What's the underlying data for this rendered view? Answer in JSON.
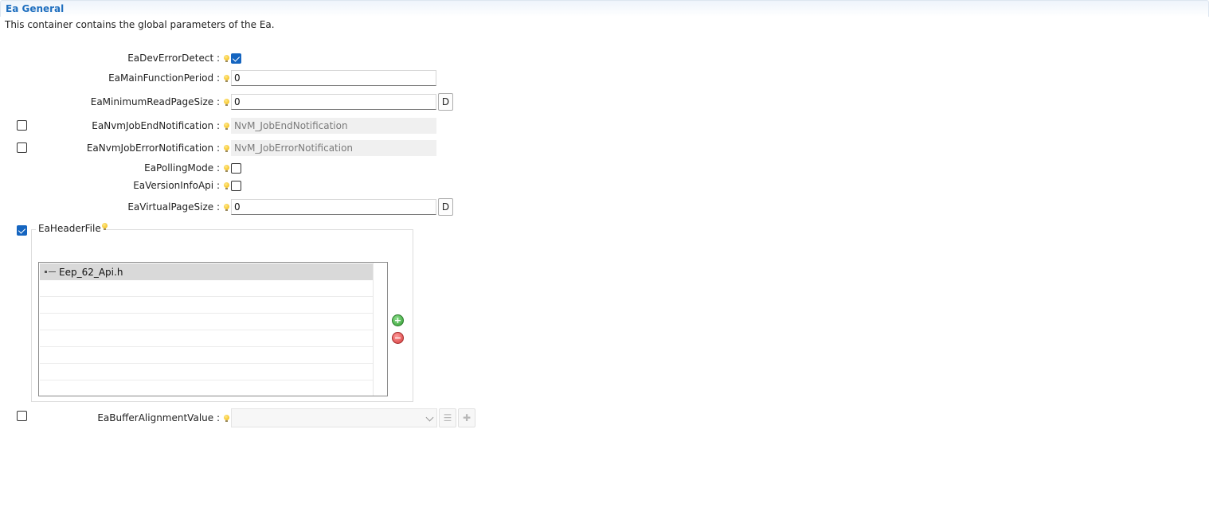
{
  "section": {
    "title": "Ea General",
    "description": "This container contains the global parameters of the Ea."
  },
  "params": {
    "dev_error_detect": {
      "label": "EaDevErrorDetect :",
      "checked": true
    },
    "main_function_period": {
      "label": "EaMainFunctionPeriod :",
      "value": "0"
    },
    "minimum_read_page_size": {
      "label": "EaMinimumReadPageSize :",
      "value": "0",
      "default_button": "D"
    },
    "nvm_job_end_notification": {
      "label": "EaNvmJobEndNotification :",
      "enabled": false,
      "value": "NvM_JobEndNotification"
    },
    "nvm_job_error_notification": {
      "label": "EaNvmJobErrorNotification :",
      "enabled": false,
      "value": "NvM_JobErrorNotification"
    },
    "polling_mode": {
      "label": "EaPollingMode :",
      "checked": false
    },
    "version_info_api": {
      "label": "EaVersionInfoApi :",
      "checked": false
    },
    "virtual_page_size": {
      "label": "EaVirtualPageSize :",
      "value": "0",
      "default_button": "D"
    },
    "header_file": {
      "label": "EaHeaderFile",
      "enabled": true,
      "items": [
        "Eep_62_Api.h"
      ]
    },
    "buffer_alignment_value": {
      "label": "EaBufferAlignmentValue :",
      "enabled": false,
      "value": ""
    }
  },
  "icons": {
    "info": "lightbulb-icon",
    "add": "plus-circle-icon",
    "remove": "minus-circle-icon",
    "list": "list-icon",
    "add_ref": "plus-icon"
  }
}
